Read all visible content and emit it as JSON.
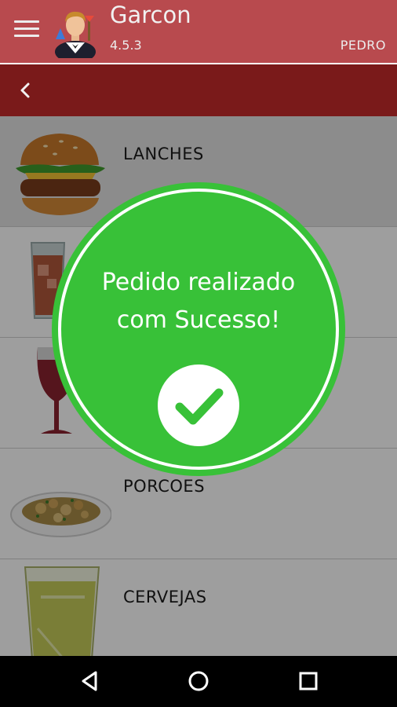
{
  "appbar": {
    "title": "Garcon",
    "version": "4.5.3",
    "user": "PEDRO",
    "menu_icon": "hamburger-menu-icon",
    "avatar_icon": "waiter-avatar-icon"
  },
  "backbar": {
    "back_icon": "chevron-left-icon"
  },
  "categories": [
    {
      "label": "LANCHES",
      "icon": "burger-icon",
      "selected": true
    },
    {
      "label": "",
      "icon": "drink-glass-icon"
    },
    {
      "label": "",
      "icon": "wine-glass-icon"
    },
    {
      "label": "PORCOES",
      "icon": "food-plate-icon"
    },
    {
      "label": "CERVEJAS",
      "icon": "beer-glass-icon"
    }
  ],
  "dialog": {
    "message_line1": "Pedido realizado",
    "message_line2": "com Sucesso!",
    "confirm_icon": "check-icon"
  },
  "navbar": {
    "back": "nav-back-icon",
    "home": "nav-home-icon",
    "recents": "nav-recents-icon"
  },
  "colors": {
    "appbar": "#b84a4e",
    "backbar": "#7a1a1a",
    "success": "#38c138",
    "check": "#38c138"
  }
}
